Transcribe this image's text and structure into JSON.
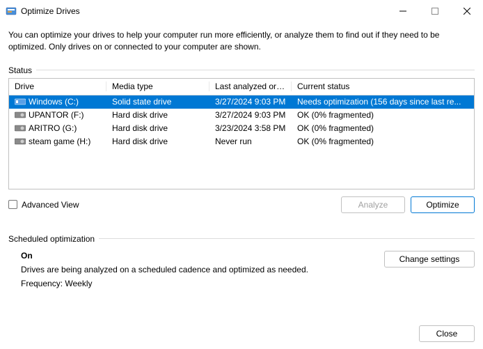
{
  "window": {
    "title": "Optimize Drives"
  },
  "description": "You can optimize your drives to help your computer run more efficiently, or analyze them to find out if they need to be optimized. Only drives on or connected to your computer are shown.",
  "status": {
    "label": "Status",
    "columns": {
      "drive": "Drive",
      "media": "Media type",
      "last": "Last analyzed or o...",
      "status": "Current status"
    },
    "rows": [
      {
        "drive": "Windows (C:)",
        "media": "Solid state drive",
        "last": "3/27/2024 9:03 PM",
        "status": "Needs optimization (156 days since last re...",
        "selected": true,
        "iconType": "ssd"
      },
      {
        "drive": "UPANTOR (F:)",
        "media": "Hard disk drive",
        "last": "3/27/2024 9:03 PM",
        "status": "OK (0% fragmented)",
        "selected": false,
        "iconType": "hdd"
      },
      {
        "drive": "ARITRO  (G:)",
        "media": "Hard disk drive",
        "last": "3/23/2024 3:58 PM",
        "status": "OK (0% fragmented)",
        "selected": false,
        "iconType": "hdd"
      },
      {
        "drive": "steam game (H:)",
        "media": "Hard disk drive",
        "last": "Never run",
        "status": "OK (0% fragmented)",
        "selected": false,
        "iconType": "hdd"
      }
    ]
  },
  "advancedView": {
    "label": "Advanced View",
    "checked": false
  },
  "buttons": {
    "analyze": "Analyze",
    "optimize": "Optimize",
    "changeSettings": "Change settings",
    "close": "Close"
  },
  "scheduled": {
    "label": "Scheduled optimization",
    "state": "On",
    "description": "Drives are being analyzed on a scheduled cadence and optimized as needed.",
    "frequency": "Frequency: Weekly"
  }
}
